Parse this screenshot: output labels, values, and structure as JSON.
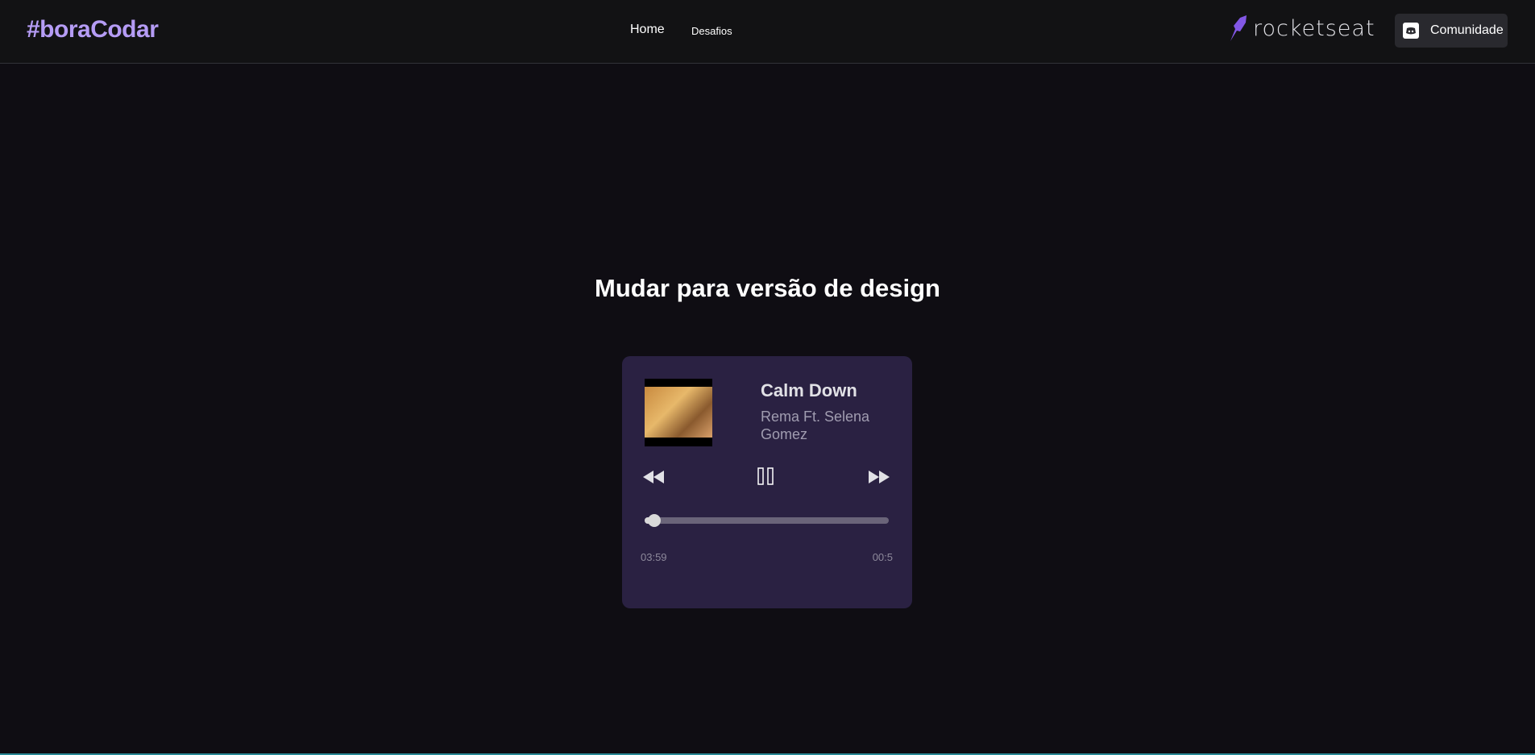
{
  "header": {
    "brand": "#boraCodar",
    "nav": [
      "Home",
      "Desafios"
    ],
    "logo_text": "rocketseat",
    "community_label": "Comunidade"
  },
  "main": {
    "title": "Mudar para versão de design"
  },
  "player": {
    "song": "Calm Down",
    "artist": "Rema Ft. Selena Gomez",
    "elapsed": "03:59",
    "remaining": "00:5",
    "progress_percent": 4,
    "state": "playing",
    "accent": "#b59cf5",
    "card_bg": "#2a2142"
  }
}
